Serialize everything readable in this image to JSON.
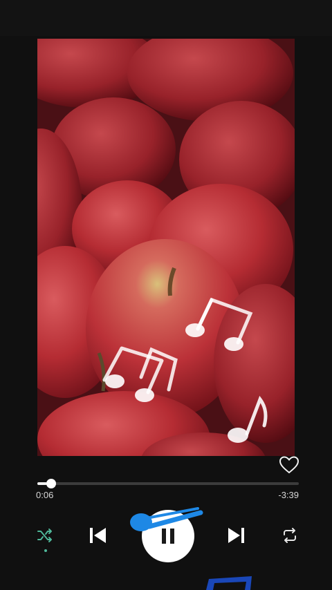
{
  "player": {
    "elapsed": "0:06",
    "remaining": "-3:39",
    "progress_fraction": 0.037,
    "shuffle_active": true,
    "liked": false
  },
  "colors": {
    "shuffle_accent": "#4fb89a",
    "overlay_blue": "#1e88e5",
    "background": "#101010"
  },
  "icons": {
    "like": "heart-outline-icon",
    "shuffle": "shuffle-icon",
    "previous": "skip-previous-icon",
    "play_pause": "pause-icon",
    "next": "skip-next-icon",
    "repeat": "repeat-icon"
  }
}
